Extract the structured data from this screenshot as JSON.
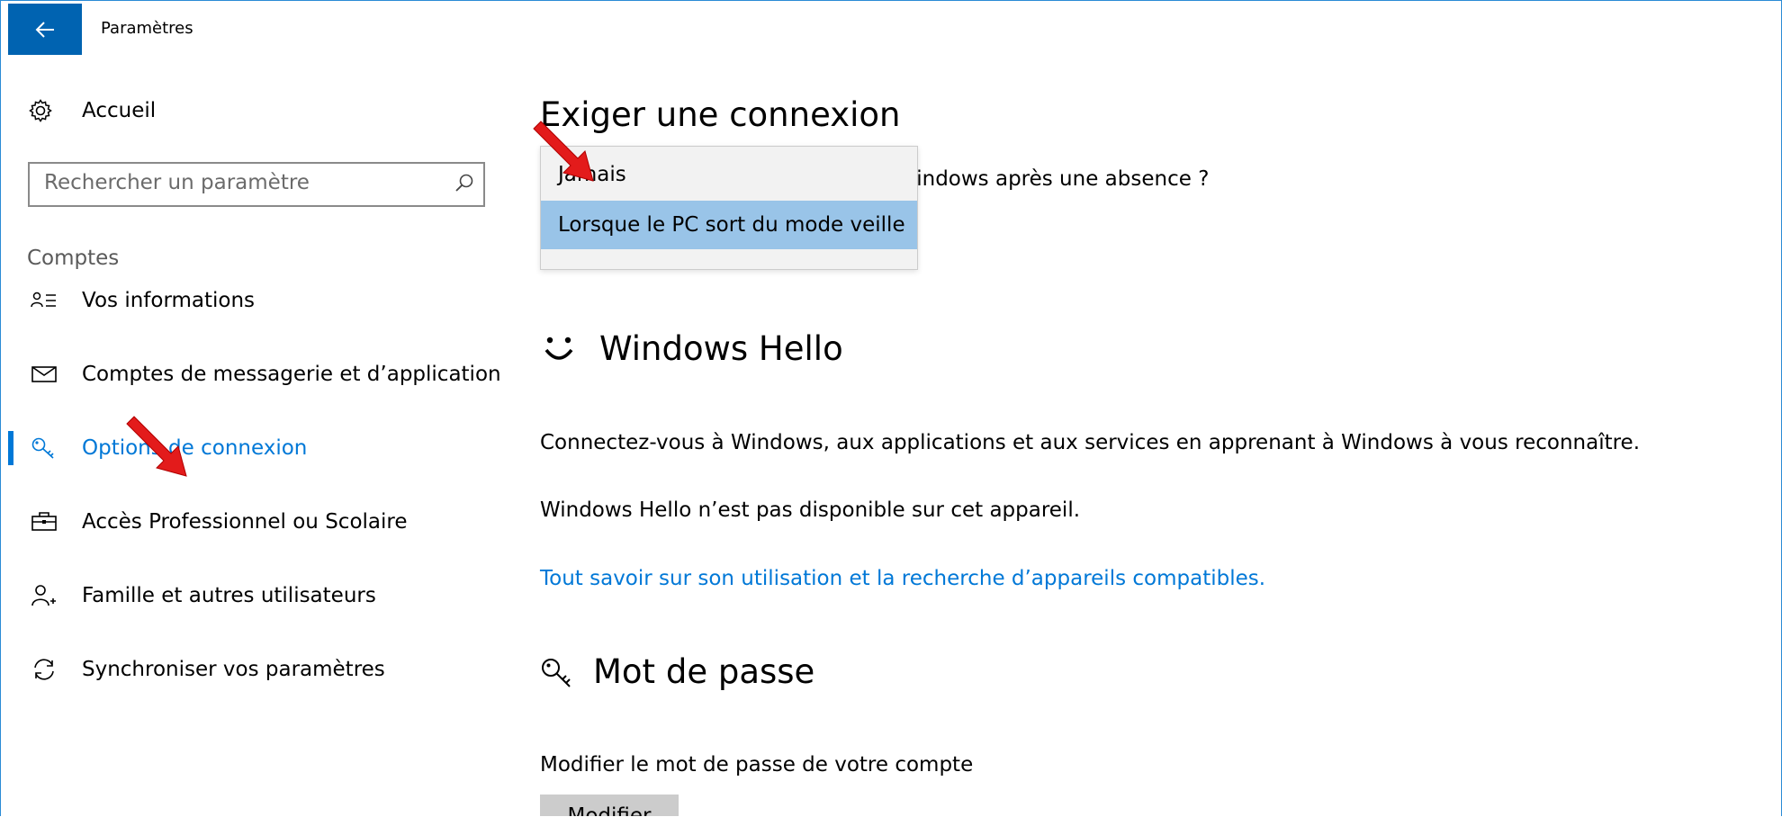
{
  "window": {
    "title": "Paramètres",
    "accent_color": "#0078d7"
  },
  "sidebar": {
    "home_label": "Accueil",
    "search_placeholder": "Rechercher un paramètre",
    "section_title": "Comptes",
    "items": [
      {
        "label": "Vos informations",
        "icon": "person-list-icon"
      },
      {
        "label": "Comptes de messagerie et d’application",
        "icon": "mail-icon"
      },
      {
        "label": "Options de connexion",
        "icon": "key-icon",
        "active": true
      },
      {
        "label": "Accès Professionnel ou Scolaire",
        "icon": "briefcase-icon"
      },
      {
        "label": "Famille et autres utilisateurs",
        "icon": "add-person-icon"
      },
      {
        "label": "Synchroniser vos paramètres",
        "icon": "sync-icon"
      }
    ]
  },
  "main": {
    "require_signin": {
      "title": "Exiger une connexion",
      "question_partial": "Vindows après une absence ?",
      "dropdown_options": [
        "Jamais",
        "Lorsque le PC sort du mode veille"
      ],
      "selected_option": "Lorsque le PC sort du mode veille"
    },
    "windows_hello": {
      "title": "Windows Hello",
      "description": "Connectez-vous à Windows, aux applications et aux services en apprenant à Windows à vous reconnaître.",
      "unavailable": "Windows Hello n’est pas disponible sur cet appareil.",
      "link": "Tout savoir sur son utilisation et la recherche d’appareils compatibles."
    },
    "password": {
      "title": "Mot de passe",
      "description": "Modifier le mot de passe de votre compte",
      "button_label": "Modifier"
    }
  },
  "annotation": {
    "arrow_color": "#e31b1b"
  }
}
